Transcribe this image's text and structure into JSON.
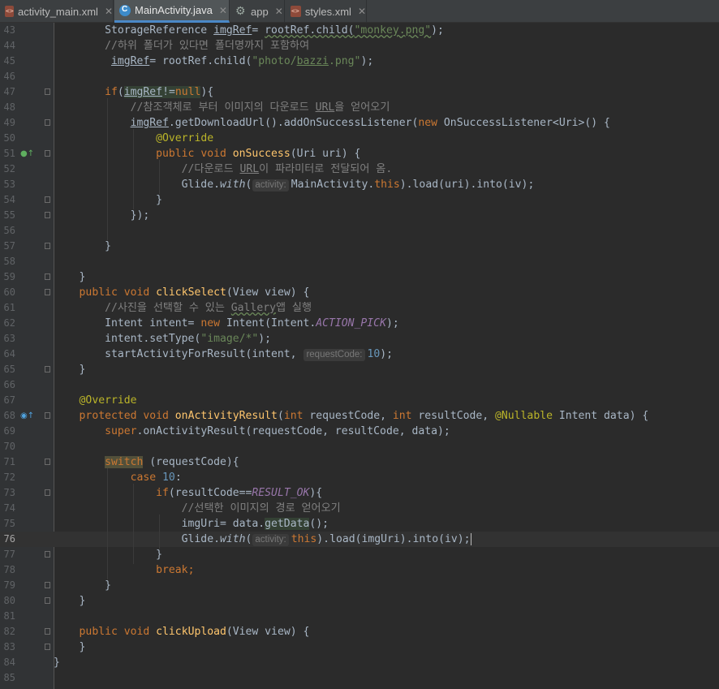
{
  "tabs": [
    {
      "label": "activity_main.xml",
      "icon": "xml-file-icon",
      "active": false,
      "close": "✕"
    },
    {
      "label": "MainActivity.java",
      "icon": "java-class-icon",
      "active": true,
      "close": "✕"
    },
    {
      "label": "app",
      "icon": "gradle-module-icon",
      "active": false,
      "close": "✕"
    },
    {
      "label": "styles.xml",
      "icon": "xml-file-icon",
      "active": false,
      "close": "✕"
    }
  ],
  "editor": {
    "current_line": 76,
    "colors": {
      "background": "#2b2b2b",
      "keyword": "#cc7832",
      "string": "#6a8759",
      "comment": "#808080",
      "annotation": "#bbb529",
      "number": "#6897bb",
      "method": "#ffc66d",
      "field": "#9876aa"
    },
    "lines": [
      {
        "n": "43",
        "fold": false,
        "mark": null,
        "segs": [
          [
            "        StorageReference ",
            ""
          ],
          [
            "imgRef",
            "ul"
          ],
          [
            "= ",
            ""
          ],
          [
            "rootRef.child(",
            "wav"
          ],
          [
            "\"monkey.png\"",
            "str wav"
          ],
          [
            ");",
            ""
          ]
        ]
      },
      {
        "n": "44",
        "fold": false,
        "mark": null,
        "segs": [
          [
            "        //하위 폴더가 있다면 폴더명까지 포함하여",
            "com"
          ]
        ]
      },
      {
        "n": "45",
        "fold": false,
        "mark": null,
        "segs": [
          [
            "         ",
            ""
          ],
          [
            "imgRef",
            "ul"
          ],
          [
            "= rootRef.child(",
            ""
          ],
          [
            "\"photo/",
            "str"
          ],
          [
            "bazzi",
            "str ul"
          ],
          [
            ".png\"",
            "str"
          ],
          [
            ");",
            ""
          ]
        ]
      },
      {
        "n": "46",
        "fold": false,
        "mark": null,
        "segs": []
      },
      {
        "n": "47",
        "fold": true,
        "mark": null,
        "segs": [
          [
            "        ",
            ""
          ],
          [
            "if",
            "kw"
          ],
          [
            "(",
            ""
          ],
          [
            "imgRef",
            "ul hl"
          ],
          [
            "!=",
            "hl"
          ],
          [
            "null",
            "kw hl"
          ],
          [
            "){",
            ""
          ]
        ]
      },
      {
        "n": "48",
        "fold": false,
        "mark": null,
        "segs": [
          [
            "            //참조객체로 부터 이미지의 다운로드 ",
            "com"
          ],
          [
            "URL",
            "com ul"
          ],
          [
            "을 얻어오기",
            "com"
          ]
        ]
      },
      {
        "n": "49",
        "fold": true,
        "mark": null,
        "segs": [
          [
            "            ",
            ""
          ],
          [
            "imgRef",
            "ul"
          ],
          [
            ".getDownloadUrl().addOnSuccessListener(",
            ""
          ],
          [
            "new ",
            "kw"
          ],
          [
            "OnSuccessListener<Uri>() {",
            ""
          ]
        ]
      },
      {
        "n": "50",
        "fold": false,
        "mark": null,
        "segs": [
          [
            "                ",
            ""
          ],
          [
            "@Override",
            "ann"
          ]
        ]
      },
      {
        "n": "51",
        "fold": true,
        "mark": "override",
        "segs": [
          [
            "                ",
            ""
          ],
          [
            "public void ",
            "kw"
          ],
          [
            "onSuccess",
            "fn"
          ],
          [
            "(Uri uri) {",
            ""
          ]
        ]
      },
      {
        "n": "52",
        "fold": false,
        "mark": null,
        "segs": [
          [
            "                    //다운로드 ",
            "com"
          ],
          [
            "URL",
            "com ul"
          ],
          [
            "이 파라미터로 전달되어 옴.",
            "com"
          ]
        ]
      },
      {
        "n": "53",
        "fold": false,
        "mark": null,
        "segs": [
          [
            "                    Glide.",
            ""
          ],
          [
            "with",
            "it"
          ],
          [
            "(",
            ""
          ],
          [
            "activity:",
            "hint"
          ],
          [
            "MainActivity.",
            ""
          ],
          [
            "this",
            "kw"
          ],
          [
            ").load(uri).into(iv);",
            ""
          ]
        ]
      },
      {
        "n": "54",
        "fold": true,
        "mark": null,
        "segs": [
          [
            "                }",
            ""
          ]
        ]
      },
      {
        "n": "55",
        "fold": true,
        "mark": null,
        "segs": [
          [
            "            });",
            ""
          ]
        ]
      },
      {
        "n": "56",
        "fold": false,
        "mark": null,
        "segs": []
      },
      {
        "n": "57",
        "fold": true,
        "mark": null,
        "segs": [
          [
            "        }",
            ""
          ]
        ]
      },
      {
        "n": "58",
        "fold": false,
        "mark": null,
        "segs": []
      },
      {
        "n": "59",
        "fold": true,
        "mark": null,
        "segs": [
          [
            "    }",
            ""
          ]
        ]
      },
      {
        "n": "60",
        "fold": true,
        "mark": null,
        "segs": [
          [
            "    ",
            ""
          ],
          [
            "public void ",
            "kw"
          ],
          [
            "clickSelect",
            "fn"
          ],
          [
            "(View view) {",
            ""
          ]
        ]
      },
      {
        "n": "61",
        "fold": false,
        "mark": null,
        "segs": [
          [
            "        //사진을 선택할 수 있는 ",
            "com"
          ],
          [
            "Gallery",
            "com wav"
          ],
          [
            "앱 실행",
            "com"
          ]
        ]
      },
      {
        "n": "62",
        "fold": false,
        "mark": null,
        "segs": [
          [
            "        Intent intent= ",
            ""
          ],
          [
            "new ",
            "kw"
          ],
          [
            "Intent(Intent.",
            ""
          ],
          [
            "ACTION_PICK",
            "fld"
          ],
          [
            ");",
            ""
          ]
        ]
      },
      {
        "n": "63",
        "fold": false,
        "mark": null,
        "segs": [
          [
            "        intent.setType(",
            ""
          ],
          [
            "\"image/*\"",
            "str"
          ],
          [
            ");",
            ""
          ]
        ]
      },
      {
        "n": "64",
        "fold": false,
        "mark": null,
        "segs": [
          [
            "        startActivityForResult(intent, ",
            ""
          ],
          [
            "requestCode:",
            "hint"
          ],
          [
            "10",
            "num"
          ],
          [
            ");",
            ""
          ]
        ]
      },
      {
        "n": "65",
        "fold": true,
        "mark": null,
        "segs": [
          [
            "    }",
            ""
          ]
        ]
      },
      {
        "n": "66",
        "fold": false,
        "mark": null,
        "segs": []
      },
      {
        "n": "67",
        "fold": false,
        "mark": null,
        "segs": [
          [
            "    ",
            ""
          ],
          [
            "@Override",
            "ann"
          ]
        ]
      },
      {
        "n": "68",
        "fold": true,
        "mark": "override-debug",
        "segs": [
          [
            "    ",
            ""
          ],
          [
            "protected void ",
            "kw"
          ],
          [
            "onActivityResult",
            "fn"
          ],
          [
            "(",
            ""
          ],
          [
            "int ",
            "kw"
          ],
          [
            "requestCode, ",
            ""
          ],
          [
            "int ",
            "kw"
          ],
          [
            "resultCode, ",
            ""
          ],
          [
            "@Nullable ",
            "ann"
          ],
          [
            "Intent data) {",
            ""
          ]
        ]
      },
      {
        "n": "69",
        "fold": false,
        "mark": null,
        "segs": [
          [
            "        ",
            ""
          ],
          [
            "super",
            "kw"
          ],
          [
            ".onActivityResult(requestCode, resultCode, data);",
            ""
          ]
        ]
      },
      {
        "n": "70",
        "fold": false,
        "mark": null,
        "segs": []
      },
      {
        "n": "71",
        "fold": true,
        "mark": null,
        "segs": [
          [
            "        ",
            ""
          ],
          [
            "switch",
            "kw hl2"
          ],
          [
            " (requestCode){",
            ""
          ]
        ]
      },
      {
        "n": "72",
        "fold": false,
        "mark": null,
        "segs": [
          [
            "            ",
            ""
          ],
          [
            "case ",
            "kw"
          ],
          [
            "10",
            "num"
          ],
          [
            ":",
            ""
          ]
        ]
      },
      {
        "n": "73",
        "fold": true,
        "mark": null,
        "segs": [
          [
            "                ",
            ""
          ],
          [
            "if",
            "kw"
          ],
          [
            "(resultCode==",
            ""
          ],
          [
            "RESULT_OK",
            "fld"
          ],
          [
            "){",
            ""
          ]
        ]
      },
      {
        "n": "74",
        "fold": false,
        "mark": null,
        "segs": [
          [
            "                    //선택한 이미지의 경로 얻어오기",
            "com"
          ]
        ]
      },
      {
        "n": "75",
        "fold": false,
        "mark": null,
        "segs": [
          [
            "                    imgUri= data.",
            ""
          ],
          [
            "getData",
            "hl"
          ],
          [
            "();",
            ""
          ]
        ]
      },
      {
        "n": "76",
        "fold": false,
        "mark": null,
        "segs": [
          [
            "                    Glide.",
            ""
          ],
          [
            "with",
            "it"
          ],
          [
            "(",
            ""
          ],
          [
            "activity:",
            "hint"
          ],
          [
            "this",
            "kw"
          ],
          [
            ").load(imgUri).into(iv);",
            ""
          ]
        ]
      },
      {
        "n": "77",
        "fold": true,
        "mark": null,
        "segs": [
          [
            "                }",
            ""
          ]
        ]
      },
      {
        "n": "78",
        "fold": false,
        "mark": null,
        "segs": [
          [
            "                ",
            ""
          ],
          [
            "break",
            "kw"
          ],
          [
            ";",
            "kw"
          ]
        ]
      },
      {
        "n": "79",
        "fold": true,
        "mark": null,
        "segs": [
          [
            "        }",
            ""
          ]
        ]
      },
      {
        "n": "80",
        "fold": true,
        "mark": null,
        "segs": [
          [
            "    }",
            ""
          ]
        ]
      },
      {
        "n": "81",
        "fold": false,
        "mark": null,
        "segs": []
      },
      {
        "n": "82",
        "fold": true,
        "mark": null,
        "segs": [
          [
            "    ",
            ""
          ],
          [
            "public void ",
            "kw"
          ],
          [
            "clickUpload",
            "fn"
          ],
          [
            "(View view) {",
            ""
          ]
        ]
      },
      {
        "n": "83",
        "fold": true,
        "mark": null,
        "segs": [
          [
            "    }",
            ""
          ]
        ]
      },
      {
        "n": "84",
        "fold": false,
        "mark": null,
        "segs": [
          [
            "}",
            ""
          ]
        ]
      },
      {
        "n": "85",
        "fold": false,
        "mark": null,
        "segs": []
      }
    ]
  }
}
